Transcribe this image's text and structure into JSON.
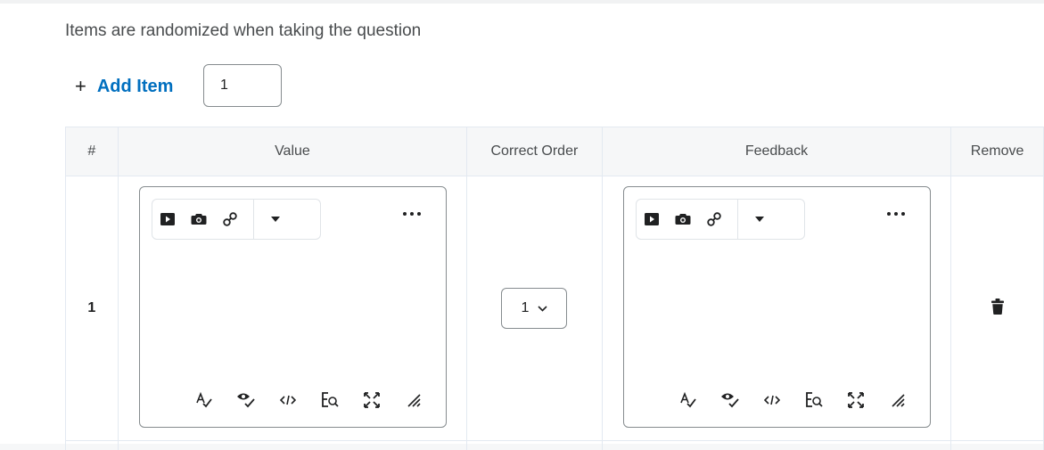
{
  "hint": "Items are randomized when taking the question",
  "add_item": {
    "plus": "+",
    "label": "Add Item",
    "count": "1"
  },
  "table": {
    "headers": [
      "#",
      "Value",
      "Correct Order",
      "Feedback",
      "Remove"
    ],
    "rows": [
      {
        "index": "1",
        "correct_order": "1"
      }
    ]
  },
  "editor": {
    "toolbar_icons": [
      "insert-media-icon",
      "insert-image-icon",
      "insert-link-icon",
      "more-insert-dropdown-icon"
    ],
    "bottom_icons": [
      "spellcheck-icon",
      "accessibility-checker-icon",
      "source-code-icon",
      "find-replace-icon",
      "fullscreen-icon",
      "resize-handle-icon"
    ]
  }
}
